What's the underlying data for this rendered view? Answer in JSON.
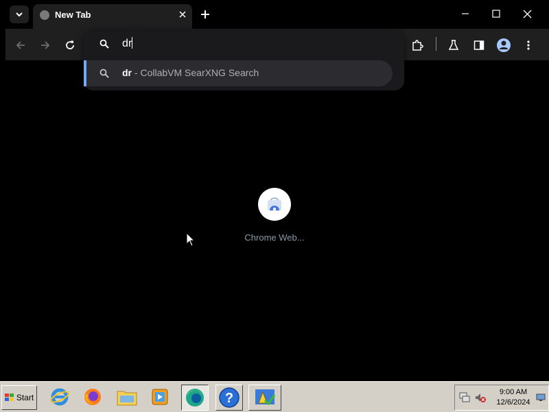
{
  "browser": {
    "tab": {
      "title": "New Tab"
    },
    "omnibox": {
      "value": "dr",
      "suggestion": {
        "query": "dr",
        "separator": " - ",
        "description": "CollabVM SearXNG Search"
      }
    },
    "shortcut": {
      "label": "Chrome Web..."
    },
    "colors": {
      "background": "#000000",
      "toolbar": "#1f1f1f",
      "omnibox": "#1a1a1c",
      "accent": "#7aa7f5"
    }
  },
  "taskbar": {
    "start_label": "Start",
    "quick_launch": [
      "internet-explorer-icon",
      "firefox-icon",
      "file-explorer-icon",
      "media-player-icon",
      "edge-icon",
      "help-icon",
      "system-icon"
    ],
    "clock": {
      "time": "9:00 AM",
      "date": "12/6/2024"
    }
  }
}
